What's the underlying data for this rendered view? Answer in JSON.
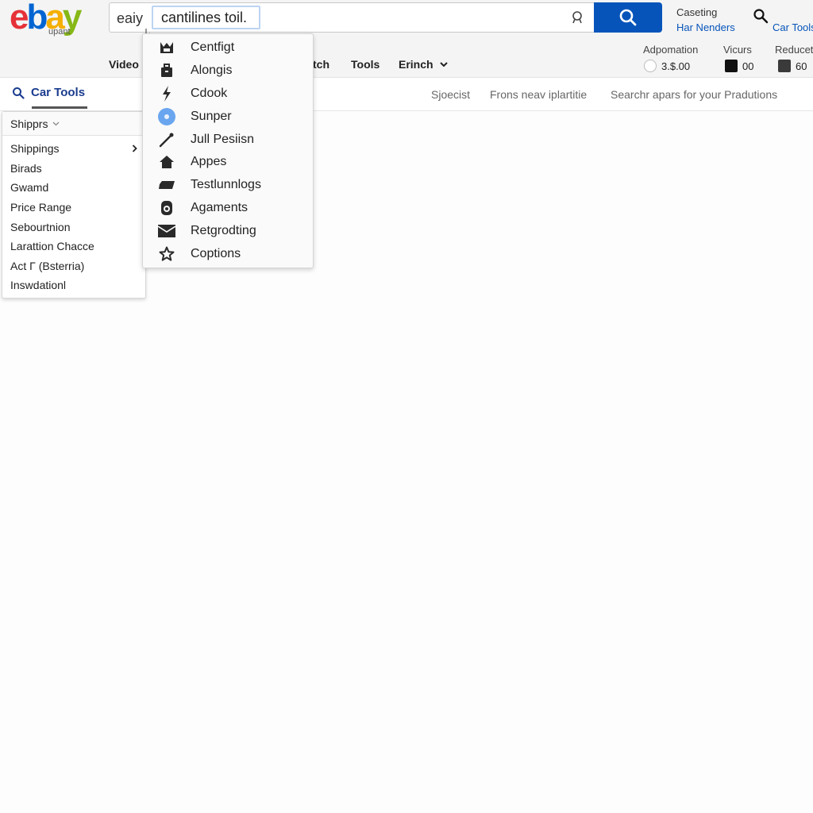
{
  "logo": {
    "text_e": "e",
    "text_b": "b",
    "text_a": "a",
    "text_y": "y",
    "sub": "upant"
  },
  "search": {
    "prefix": "eaiy",
    "value": "cantilines toil.",
    "button_icon": "search-icon",
    "user_icon": "user-icon"
  },
  "header_right": {
    "label_top": "Caseting",
    "link": "Har Nenders",
    "search_icon": "magnifier-icon",
    "car_tools_link": "Car Tools"
  },
  "nav": {
    "items": [
      "Video",
      "tch",
      "Tools",
      "Erinch"
    ]
  },
  "filters": [
    {
      "label": "Adpomation",
      "value": "3.$.00",
      "control": "radio"
    },
    {
      "label": "Vicurs",
      "value": "00",
      "control": "swatch",
      "color": "#111111"
    },
    {
      "label": "Reducet",
      "value": "60",
      "control": "swatch",
      "color": "#3a3a3a"
    }
  ],
  "subbar": {
    "active_tab": "Car Tools",
    "links": [
      "Sjoecist",
      "Frons neav iplartitie",
      "Searchr apars for your Pradutions"
    ]
  },
  "left_menu": {
    "header": "Shipprs",
    "items": [
      {
        "label": "Shippings",
        "has_submenu": true
      },
      {
        "label": "Birads"
      },
      {
        "label": "Gwamd"
      },
      {
        "label": "Price Range"
      },
      {
        "label": "Sebourtnion"
      },
      {
        "label": "Larattion Chacce"
      },
      {
        "label": "Act Γ (Bsterria)"
      },
      {
        "label": "Inswdationl"
      }
    ]
  },
  "dropdown": {
    "items": [
      {
        "label": "Centfigt",
        "icon": "crown-icon"
      },
      {
        "label": "Alongis",
        "icon": "briefcase-icon"
      },
      {
        "label": "Cdook",
        "icon": "lightning-icon"
      },
      {
        "label": "Sunper",
        "icon": "disc-icon"
      },
      {
        "label": "Jull Pesiisn",
        "icon": "wrench-icon"
      },
      {
        "label": "Appes",
        "icon": "home-icon"
      },
      {
        "label": "Testlunnlogs",
        "icon": "tag-icon"
      },
      {
        "label": "Agaments",
        "icon": "badge-icon"
      },
      {
        "label": "Retgrodting",
        "icon": "envelope-icon"
      },
      {
        "label": "Coptions",
        "icon": "star-icon"
      }
    ]
  },
  "colors": {
    "accent": "#0654ba",
    "tab_text": "#1a3c8f"
  }
}
